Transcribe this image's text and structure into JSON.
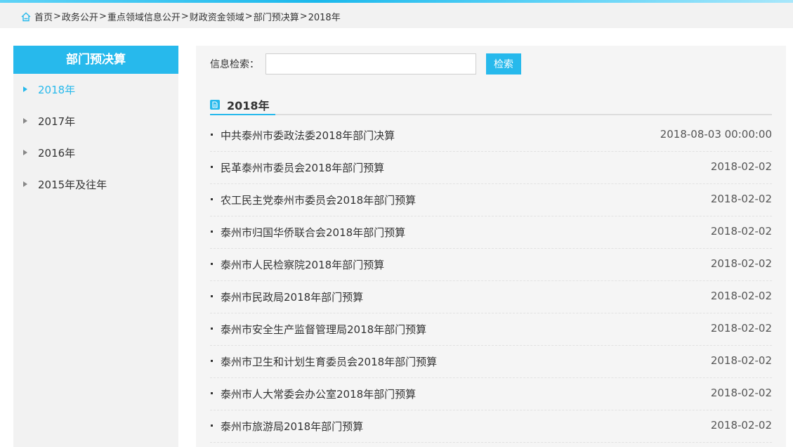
{
  "breadcrumb": {
    "items": [
      "首页",
      "政务公开",
      "重点领域信息公开",
      "财政资金领域",
      "部门预决算",
      "2018年"
    ],
    "separator": ">"
  },
  "sidebar": {
    "title": "部门预决算",
    "items": [
      {
        "label": "2018年",
        "active": true
      },
      {
        "label": "2017年",
        "active": false
      },
      {
        "label": "2016年",
        "active": false
      },
      {
        "label": "2015年及往年",
        "active": false
      }
    ]
  },
  "search": {
    "label": "信息检索：",
    "value": "",
    "placeholder": "",
    "button_label": "检索"
  },
  "section": {
    "title": "2018年"
  },
  "articles": [
    {
      "title": "中共泰州市委政法委2018年部门决算",
      "date": "2018-08-03 00:00:00"
    },
    {
      "title": "民革泰州市委员会2018年部门预算",
      "date": "2018-02-02"
    },
    {
      "title": "农工民主党泰州市委员会2018年部门预算",
      "date": "2018-02-02"
    },
    {
      "title": "泰州市归国华侨联合会2018年部门预算",
      "date": "2018-02-02"
    },
    {
      "title": "泰州市人民检察院2018年部门预算",
      "date": "2018-02-02"
    },
    {
      "title": "泰州市民政局2018年部门预算",
      "date": "2018-02-02"
    },
    {
      "title": "泰州市安全生产监督管理局2018年部门预算",
      "date": "2018-02-02"
    },
    {
      "title": "泰州市卫生和计划生育委员会2018年部门预算",
      "date": "2018-02-02"
    },
    {
      "title": "泰州市人大常委会办公室2018年部门预算",
      "date": "2018-02-02"
    },
    {
      "title": "泰州市旅游局2018年部门预算",
      "date": "2018-02-02"
    }
  ],
  "colors": {
    "accent": "#27b9ec",
    "panel_bg": "#f2f2f2",
    "text": "#333333"
  },
  "icons": {
    "breadcrumb": "home-icon",
    "section": "document-icon",
    "sidebar_item": "triangle-right-icon",
    "list_item": "bullet-icon"
  }
}
